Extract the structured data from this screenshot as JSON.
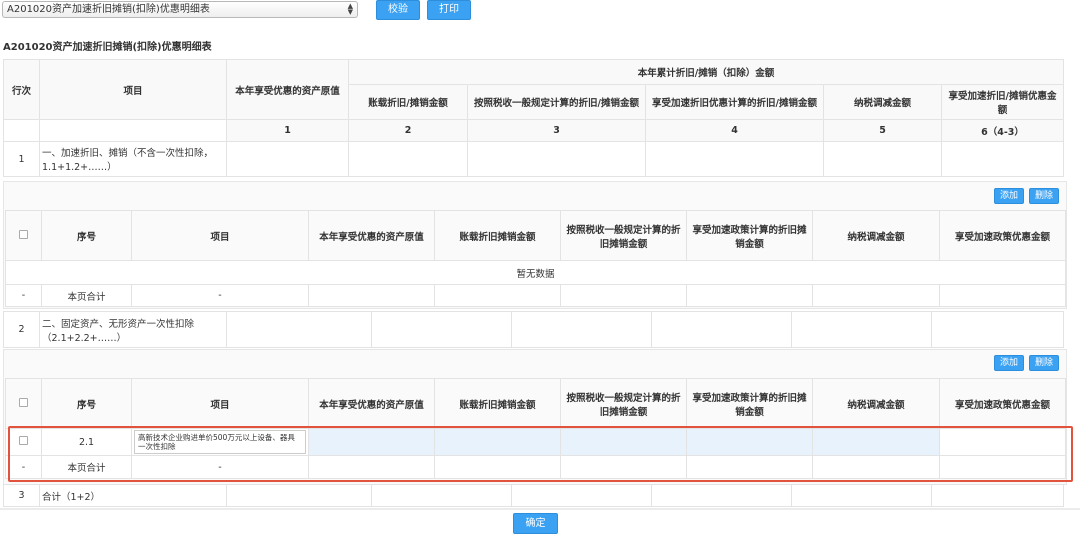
{
  "toolbar": {
    "form_select": "A201020资产加速折旧摊销(扣除)优惠明细表",
    "check_button": "校验",
    "print_button": "打印"
  },
  "form": {
    "title": "A201020资产加速折旧摊销(扣除)优惠明细表",
    "header": {
      "row_no": "行次",
      "item": "项目",
      "asset_value": "本年享受优惠的资产原值",
      "accumulated": "本年累计折旧/摊销（扣除）金额",
      "cols": [
        "账载折旧/摊销金额",
        "按照税收一般规定计算的折旧/摊销金额",
        "享受加速折旧优惠计算的折旧/摊销金额",
        "纳税调减金额",
        "享受加速折旧/摊销优惠金额"
      ],
      "col_numbers": [
        "1",
        "2",
        "3",
        "4",
        "5",
        "6（4-3）"
      ]
    },
    "row1": {
      "no": "1",
      "label": "一、加速折旧、摊销（不含一次性扣除，1.1+1.2+……）"
    },
    "row2": {
      "no": "2",
      "label": "二、固定资产、无形资产一次性扣除（2.1+2.2+……）"
    },
    "row3": {
      "no": "3",
      "label": "合计（1+2）"
    },
    "sub_header": {
      "seq": "序号",
      "item": "项目",
      "asset_value": "本年享受优惠的资产原值",
      "book": "账载折旧摊销金额",
      "tax_general": "按照税收一般规定计算的折旧摊销金额",
      "accel": "享受加速政策计算的折旧摊销金额",
      "reduce": "纳税调减金额",
      "benefit": "享受加速政策优惠金额"
    },
    "sub1": {
      "add_button": "添加",
      "delete_button": "删除",
      "empty_text": "暂无数据",
      "subtotal_dash": "-",
      "subtotal_label": "本页合计",
      "subtotal_item_dash": "-"
    },
    "sub2": {
      "add_button": "添加",
      "delete_button": "删除",
      "row_seq": "2.1",
      "row_item": "高新技术企业购进单价500万元以上设备、器具一次性扣除",
      "subtotal_dash": "-",
      "subtotal_label": "本页合计",
      "subtotal_item_dash": "-"
    },
    "confirm_button": "确定"
  }
}
